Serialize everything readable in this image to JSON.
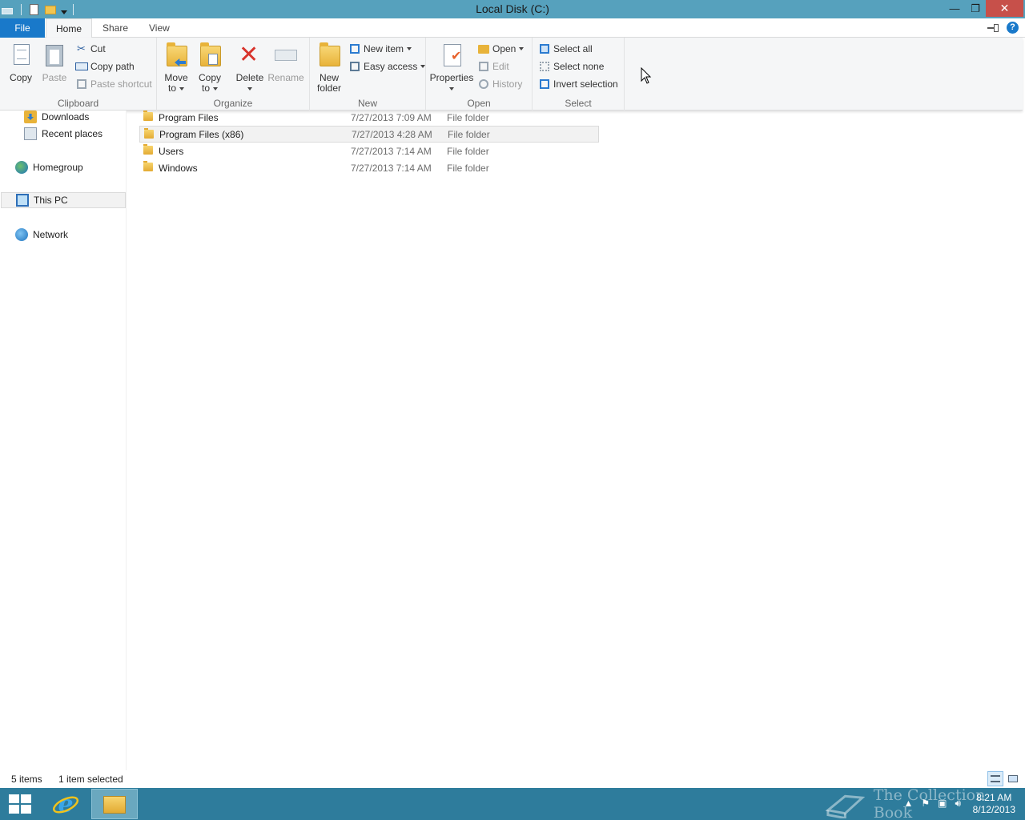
{
  "window": {
    "title": "Local Disk (C:)",
    "minimize_glyph": "—",
    "restore_glyph": "❐",
    "close_glyph": "✕"
  },
  "ribbon_tabs": [
    {
      "label": "File"
    },
    {
      "label": "Home"
    },
    {
      "label": "Share"
    },
    {
      "label": "View"
    }
  ],
  "help_glyph": "?",
  "ribbon": {
    "clipboard": {
      "label": "Clipboard",
      "copy": "Copy",
      "paste": "Paste",
      "cut": "Cut",
      "copy_path": "Copy path",
      "paste_shortcut": "Paste shortcut"
    },
    "organize": {
      "label": "Organize",
      "move_to_1": "Move",
      "move_to_2": "to",
      "copy_to_1": "Copy",
      "copy_to_2": "to",
      "delete": "Delete",
      "rename": "Rename"
    },
    "new": {
      "label": "New",
      "new_folder_1": "New",
      "new_folder_2": "folder",
      "new_item": "New item",
      "easy_access": "Easy access"
    },
    "open": {
      "label": "Open",
      "properties": "Properties",
      "open": "Open",
      "edit": "Edit",
      "history": "History"
    },
    "select": {
      "label": "Select",
      "select_all": "Select all",
      "select_none": "Select none",
      "invert_selection": "Invert selection"
    }
  },
  "nav": {
    "downloads": "Downloads",
    "recent_places": "Recent places",
    "homegroup": "Homegroup",
    "this_pc": "This PC",
    "network": "Network"
  },
  "files": [
    {
      "name": "Program Files",
      "date": "7/27/2013 7:09 AM",
      "type": "File folder"
    },
    {
      "name": "Program Files (x86)",
      "date": "7/27/2013 4:28 AM",
      "type": "File folder"
    },
    {
      "name": "Users",
      "date": "7/27/2013 7:14 AM",
      "type": "File folder"
    },
    {
      "name": "Windows",
      "date": "7/27/2013 7:14 AM",
      "type": "File folder"
    }
  ],
  "status": {
    "item_count": "5 items",
    "selection": "1 item selected"
  },
  "taskbar": {
    "time": "8:21 AM",
    "date": "8/12/2013",
    "watermark": "The Collection Book"
  },
  "colors": {
    "titlebar": "#56a1bd",
    "file_tab": "#1979ca",
    "close_button": "#c7504a",
    "taskbar": "#2e7c9c"
  }
}
